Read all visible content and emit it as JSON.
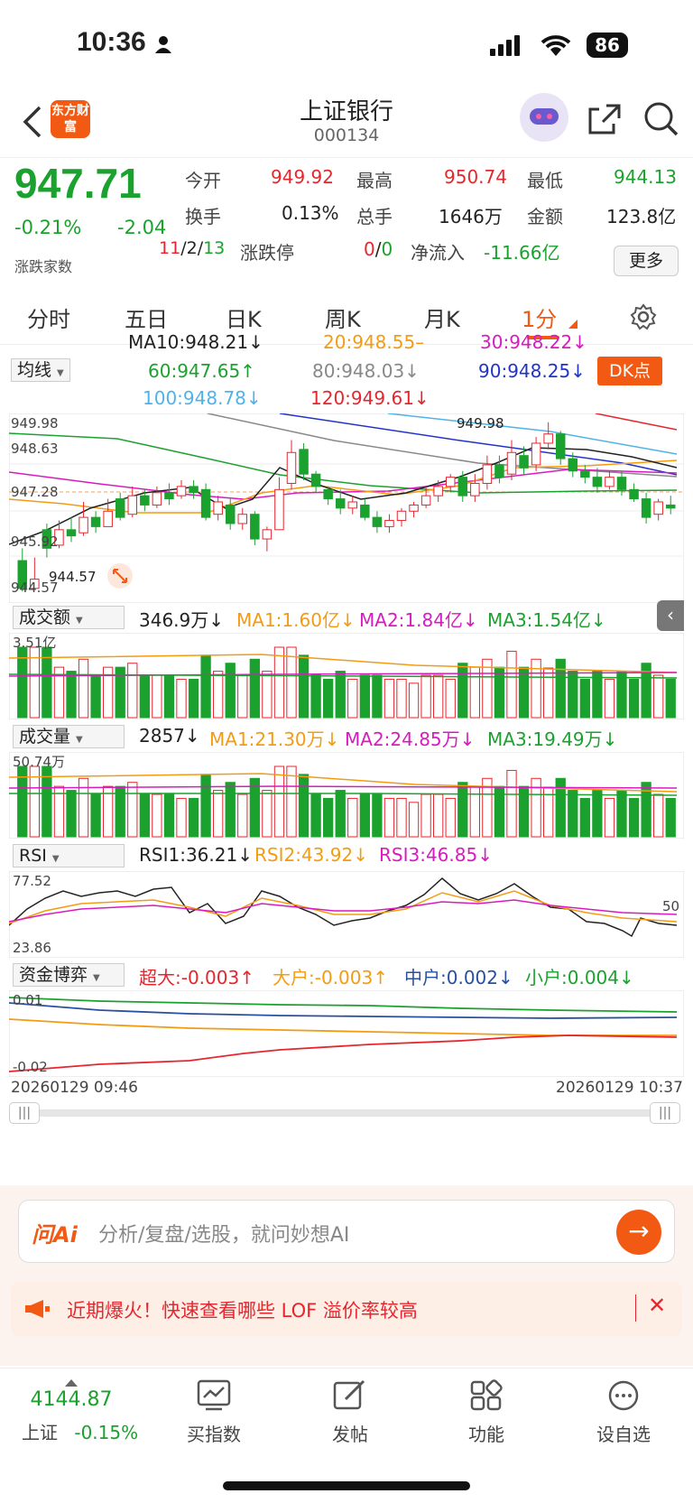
{
  "status": {
    "time": "10:36",
    "battery": "86"
  },
  "header": {
    "title": "上证银行",
    "code": "000134",
    "logo_text": "东方财富"
  },
  "quote": {
    "price": "947.71",
    "change_pct": "-0.21%",
    "change": "-2.04",
    "open_label": "今开",
    "open": "949.92",
    "high_label": "最高",
    "high": "950.74",
    "low_label": "最低",
    "low": "944.13",
    "turnover_label": "换手",
    "turnover": "0.13%",
    "volume_label": "总手",
    "volume": "1646万",
    "amount_label": "金额",
    "amount": "123.8亿",
    "breadth_label": "涨跌家数",
    "breadth_up": "11",
    "breadth_sep1": "/",
    "breadth_flat": "2",
    "breadth_sep2": "/",
    "breadth_down": "13",
    "limit_label": "涨跌停",
    "limit_up": "0",
    "limit_sep": "/",
    "limit_down": "0",
    "netflow_label": "净流入",
    "netflow": "-11.66亿",
    "more_label": "更多"
  },
  "tabs": [
    "分时",
    "五日",
    "日K",
    "周K",
    "月K",
    "1分"
  ],
  "active_tab": "1分",
  "ma": {
    "selector": "均线",
    "ma10": "MA10:948.21↓",
    "ma20": "20:948.55–",
    "ma30": "30:948.22↓",
    "ma60": "60:947.65↑",
    "ma80": "80:948.03↓",
    "ma90": "90:948.25↓",
    "ma100": "100:948.78↓",
    "ma120": "120:949.61↓",
    "dk_label": "DK点"
  },
  "kline_axis": {
    "y_top": "949.98",
    "y_2": "948.63",
    "y_3": "947.28",
    "y_4": "945.92",
    "y_bottom": "944.57",
    "high_marker": "949.98",
    "low_marker": "944.57"
  },
  "amount_panel": {
    "selector": "成交额",
    "value": "346.9万↓",
    "ma1": "MA1:1.60亿↓",
    "ma2": "MA2:1.84亿↓",
    "ma3": "MA3:1.54亿↓",
    "axis_top": "3.51亿"
  },
  "volume_panel": {
    "selector": "成交量",
    "value": "2857↓",
    "ma1": "MA1:21.30万↓",
    "ma2": "MA2:24.85万↓",
    "ma3": "MA3:19.49万↓",
    "axis_top": "50.74万"
  },
  "rsi_panel": {
    "selector": "RSI",
    "rsi1": "RSI1:36.21↓",
    "rsi2": "RSI2:43.92↓",
    "rsi3": "RSI3:46.85↓",
    "axis_top": "77.52",
    "axis_bottom": "23.86",
    "mid": "50"
  },
  "fund_panel": {
    "selector": "资金博弈",
    "super": "超大:-0.003↑",
    "large": "大户:-0.003↑",
    "mid": "中户:0.002↓",
    "small": "小户:0.004↓",
    "axis_top": "0.01",
    "axis_bottom": "-0.02"
  },
  "time_axis": {
    "start": "20260129 09:46",
    "end": "20260129 10:37"
  },
  "ai_bar": {
    "brand": "问Ai",
    "placeholder": "分析/复盘/选股，就问妙想AI"
  },
  "notice": {
    "text": "近期爆火！快速查看哪些 LOF 溢价率较高"
  },
  "bottom_nav": {
    "index_value": "4144.87",
    "index_name": "上证",
    "index_change": "-0.15%",
    "buy_index": "买指数",
    "post": "发帖",
    "function": "功能",
    "watchlist": "设自选"
  },
  "colors": {
    "up": "#e6262e",
    "down": "#1ba12e",
    "accent": "#f25a14"
  },
  "chart_data": {
    "type": "candlestick",
    "title": "",
    "price_high": 949.98,
    "price_low": 944.57,
    "candles": [
      {
        "o": 945.5,
        "c": 944.6,
        "h": 945.9,
        "l": 944.5
      },
      {
        "o": 944.6,
        "c": 944.9,
        "h": 945.6,
        "l": 944.6
      },
      {
        "o": 946.5,
        "c": 945.9,
        "h": 946.7,
        "l": 945.6
      },
      {
        "o": 946.0,
        "c": 946.5,
        "h": 946.8,
        "l": 945.9
      },
      {
        "o": 946.5,
        "c": 946.3,
        "h": 946.9,
        "l": 946.1
      },
      {
        "o": 946.4,
        "c": 946.9,
        "h": 947.4,
        "l": 946.3
      },
      {
        "o": 946.9,
        "c": 946.6,
        "h": 947.1,
        "l": 946.4
      },
      {
        "o": 946.6,
        "c": 947.1,
        "h": 947.5,
        "l": 946.6
      },
      {
        "o": 947.5,
        "c": 946.9,
        "h": 947.7,
        "l": 946.8
      },
      {
        "o": 947.0,
        "c": 947.6,
        "h": 947.9,
        "l": 946.9
      },
      {
        "o": 947.6,
        "c": 947.3,
        "h": 947.8,
        "l": 947.1
      },
      {
        "o": 947.3,
        "c": 947.7,
        "h": 947.9,
        "l": 947.2
      },
      {
        "o": 947.7,
        "c": 947.5,
        "h": 948.0,
        "l": 947.3
      },
      {
        "o": 947.6,
        "c": 947.9,
        "h": 948.1,
        "l": 947.5
      },
      {
        "o": 947.9,
        "c": 947.7,
        "h": 948.1,
        "l": 947.5
      },
      {
        "o": 947.8,
        "c": 946.9,
        "h": 948.0,
        "l": 946.8
      },
      {
        "o": 947.0,
        "c": 947.4,
        "h": 947.6,
        "l": 946.8
      },
      {
        "o": 947.3,
        "c": 946.7,
        "h": 947.5,
        "l": 946.5
      },
      {
        "o": 946.7,
        "c": 947.0,
        "h": 947.2,
        "l": 946.5
      },
      {
        "o": 947.0,
        "c": 946.2,
        "h": 947.1,
        "l": 946.0
      },
      {
        "o": 946.2,
        "c": 946.5,
        "h": 946.6,
        "l": 945.8
      },
      {
        "o": 946.5,
        "c": 947.8,
        "h": 948.2,
        "l": 946.5
      },
      {
        "o": 948.0,
        "c": 949.0,
        "h": 949.4,
        "l": 947.8
      },
      {
        "o": 949.1,
        "c": 948.3,
        "h": 949.3,
        "l": 948.1
      },
      {
        "o": 948.3,
        "c": 947.9,
        "h": 948.4,
        "l": 947.7
      },
      {
        "o": 947.8,
        "c": 947.5,
        "h": 947.9,
        "l": 947.3
      },
      {
        "o": 947.5,
        "c": 947.2,
        "h": 947.8,
        "l": 947.0
      },
      {
        "o": 947.2,
        "c": 947.4,
        "h": 947.6,
        "l": 947.0
      },
      {
        "o": 947.3,
        "c": 946.9,
        "h": 947.5,
        "l": 946.8
      },
      {
        "o": 946.9,
        "c": 946.6,
        "h": 947.1,
        "l": 946.4
      },
      {
        "o": 946.6,
        "c": 946.8,
        "h": 947.0,
        "l": 946.4
      },
      {
        "o": 946.8,
        "c": 947.1,
        "h": 947.2,
        "l": 946.6
      },
      {
        "o": 947.1,
        "c": 947.3,
        "h": 947.4,
        "l": 946.9
      },
      {
        "o": 947.3,
        "c": 947.6,
        "h": 947.9,
        "l": 947.2
      },
      {
        "o": 947.6,
        "c": 947.9,
        "h": 948.1,
        "l": 947.4
      },
      {
        "o": 947.9,
        "c": 948.2,
        "h": 948.3,
        "l": 947.7
      },
      {
        "o": 948.2,
        "c": 947.6,
        "h": 948.4,
        "l": 947.4
      },
      {
        "o": 947.6,
        "c": 948.0,
        "h": 948.3,
        "l": 947.4
      },
      {
        "o": 948.0,
        "c": 948.6,
        "h": 948.9,
        "l": 947.8
      },
      {
        "o": 948.6,
        "c": 948.2,
        "h": 948.9,
        "l": 948.0
      },
      {
        "o": 948.3,
        "c": 949.0,
        "h": 949.4,
        "l": 948.1
      },
      {
        "o": 948.9,
        "c": 948.5,
        "h": 949.2,
        "l": 948.3
      },
      {
        "o": 948.6,
        "c": 949.3,
        "h": 949.5,
        "l": 948.4
      },
      {
        "o": 949.3,
        "c": 949.6,
        "h": 949.98,
        "l": 949.1
      },
      {
        "o": 949.6,
        "c": 948.8,
        "h": 949.7,
        "l": 948.6
      },
      {
        "o": 948.8,
        "c": 948.4,
        "h": 949.0,
        "l": 948.2
      },
      {
        "o": 948.4,
        "c": 948.2,
        "h": 948.6,
        "l": 948.0
      },
      {
        "o": 948.2,
        "c": 947.9,
        "h": 948.5,
        "l": 947.7
      },
      {
        "o": 947.9,
        "c": 948.2,
        "h": 948.4,
        "l": 947.8
      },
      {
        "o": 948.2,
        "c": 947.8,
        "h": 948.4,
        "l": 947.6
      },
      {
        "o": 947.8,
        "c": 947.5,
        "h": 948.0,
        "l": 947.4
      },
      {
        "o": 947.5,
        "c": 946.9,
        "h": 947.7,
        "l": 946.7
      },
      {
        "o": 947.0,
        "c": 947.4,
        "h": 947.5,
        "l": 946.8
      },
      {
        "o": 947.3,
        "c": 947.2,
        "h": 947.6,
        "l": 947.0
      }
    ]
  }
}
